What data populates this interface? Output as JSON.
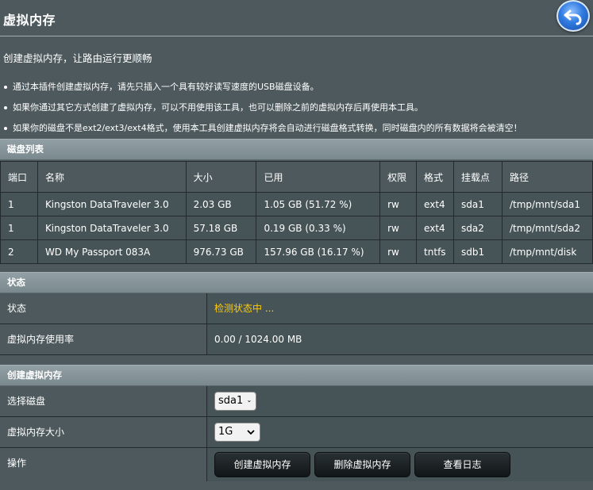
{
  "page": {
    "title": "虚拟内存",
    "subtitle": "创建虚拟内存，让路由运行更顺畅",
    "notes": [
      "通过本插件创建虚拟内存，请先只插入一个具有较好读写速度的USB磁盘设备。",
      "如果你通过其它方式创建了虚拟内存，可以不用使用该工具，也可以删除之前的虚拟内存后再使用本工具。",
      "如果你的磁盘不是ext2/ext3/ext4格式，使用本工具创建虚拟内存将会自动进行磁盘格式转换，同时磁盘内的所有数据将会被清空！"
    ]
  },
  "disk_list": {
    "section_title": "磁盘列表",
    "headers": [
      "端口",
      "名称",
      "大小",
      "已用",
      "权限",
      "格式",
      "挂载点",
      "路径"
    ],
    "rows": [
      [
        "1",
        "Kingston DataTraveler 3.0",
        "2.03 GB",
        "1.05 GB (51.72 %)",
        "rw",
        "ext4",
        "sda1",
        "/tmp/mnt/sda1"
      ],
      [
        "1",
        "Kingston DataTraveler 3.0",
        "57.18 GB",
        "0.19 GB (0.33 %)",
        "rw",
        "ext4",
        "sda2",
        "/tmp/mnt/sda2"
      ],
      [
        "2",
        "WD My Passport 083A",
        "976.73 GB",
        "157.96 GB (16.17 %)",
        "rw",
        "tntfs",
        "sdb1",
        "/tmp/mnt/disk"
      ]
    ]
  },
  "status": {
    "section_title": "状态",
    "status_label": "状态",
    "status_value": "检测状态中 ...",
    "usage_label": "虚拟内存使用率",
    "usage_value": "0.00 / 1024.00 MB"
  },
  "create": {
    "section_title": "创建虚拟内存",
    "disk_label": "选择磁盘",
    "disk_selected": "sda1",
    "size_label": "虚拟内存大小",
    "size_selected": "1G",
    "action_label": "操作",
    "btn_create": "创建虚拟内存",
    "btn_delete": "删除虚拟内存",
    "btn_log": "查看日志"
  },
  "colors": {
    "background": "#4d595d",
    "status_text": "#ffcc00",
    "back_button": "#2f7ae0"
  },
  "icons": {
    "back": "back-arrow-icon",
    "dropdown": "chevron-down-icon"
  }
}
